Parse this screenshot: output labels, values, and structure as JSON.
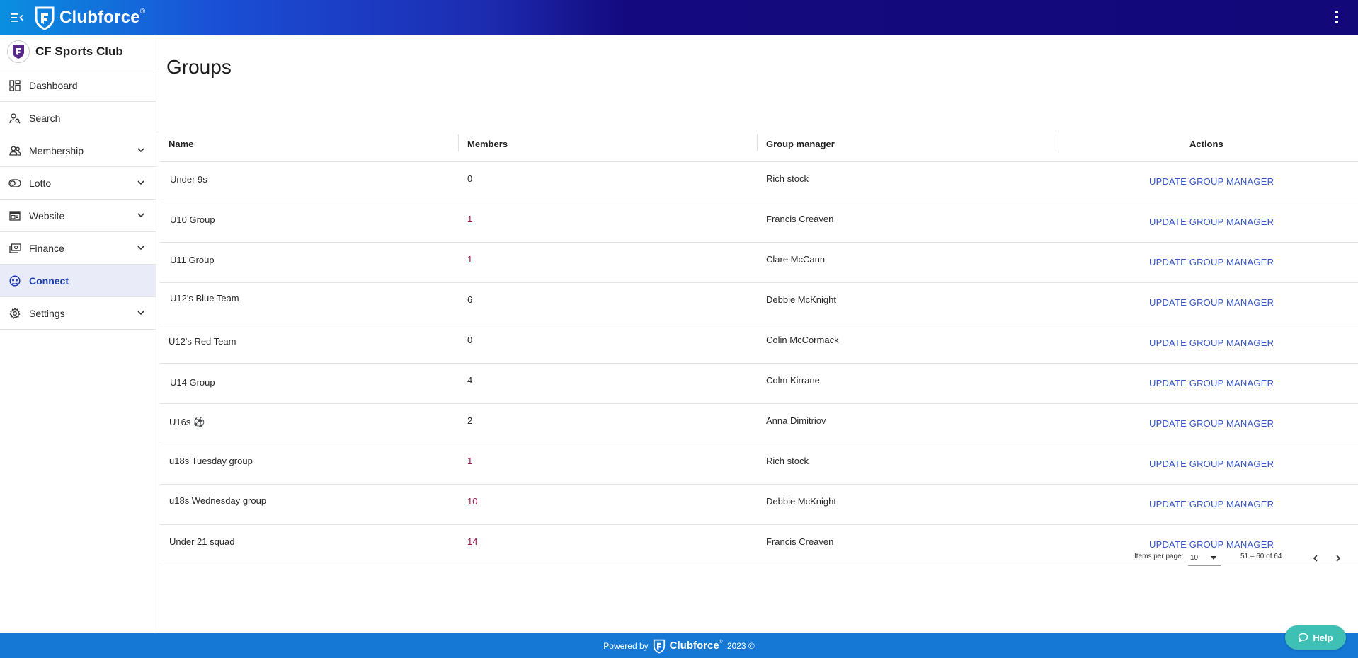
{
  "header": {
    "brand": "Clubforce",
    "brand_mark": "®"
  },
  "sidebar": {
    "club_name": "CF Sports Club",
    "items": [
      {
        "label": "Dashboard",
        "icon": "dashboard-icon",
        "expandable": false
      },
      {
        "label": "Search",
        "icon": "person-search-icon",
        "expandable": false
      },
      {
        "label": "Membership",
        "icon": "people-icon",
        "expandable": true
      },
      {
        "label": "Lotto",
        "icon": "toggle-icon",
        "expandable": true
      },
      {
        "label": "Website",
        "icon": "web-icon",
        "expandable": true
      },
      {
        "label": "Finance",
        "icon": "payments-icon",
        "expandable": true
      },
      {
        "label": "Connect",
        "icon": "connect-icon",
        "expandable": false,
        "active": true
      },
      {
        "label": "Settings",
        "icon": "gear-icon",
        "expandable": true
      }
    ]
  },
  "main": {
    "title": "Groups",
    "table": {
      "columns": [
        "Name",
        "Members",
        "Group manager",
        "Actions"
      ],
      "action_label": "UPDATE GROUP MANAGER",
      "rows": [
        {
          "name": "Under 9s",
          "members": "0",
          "manager": "Rich stock"
        },
        {
          "name": "U10 Group",
          "members": "1",
          "manager": "Francis Creaven"
        },
        {
          "name": "U11  Group",
          "members": "1",
          "manager": "Clare McCann"
        },
        {
          "name": "U12's Blue Team",
          "members": "6",
          "manager": "Debbie McKnight"
        },
        {
          "name": "U12's Red Team",
          "members": "0",
          "manager": "Colin McCormack"
        },
        {
          "name": "U14  Group",
          "members": "4",
          "manager": "Colm Kirrane"
        },
        {
          "name": "U16s ⚽",
          "members": "2",
          "manager": "Anna Dimitriov"
        },
        {
          "name": "u18s  Tuesday group",
          "members": "1",
          "manager": "Rich stock"
        },
        {
          "name": "u18s Wednesday group",
          "members": "10",
          "manager": "Debbie McKnight"
        },
        {
          "name": "Under 21 squad",
          "members": "14",
          "manager": "Francis Creaven"
        }
      ]
    },
    "paginator": {
      "items_per_page_label": "Items per page:",
      "items_per_page_value": "10",
      "range_label": "51 – 60 of 64"
    }
  },
  "footer": {
    "powered_by": "Powered by",
    "brand": "Clubforce",
    "brand_mark": "®",
    "year": "2023 ©"
  },
  "help": {
    "label": "Help"
  },
  "colors": {
    "accent": "#1e3fae",
    "action_link": "#3556c7",
    "footer_bg": "#1478d4",
    "help_bg": "#3fc0b4",
    "member_count": "#a0124c"
  }
}
